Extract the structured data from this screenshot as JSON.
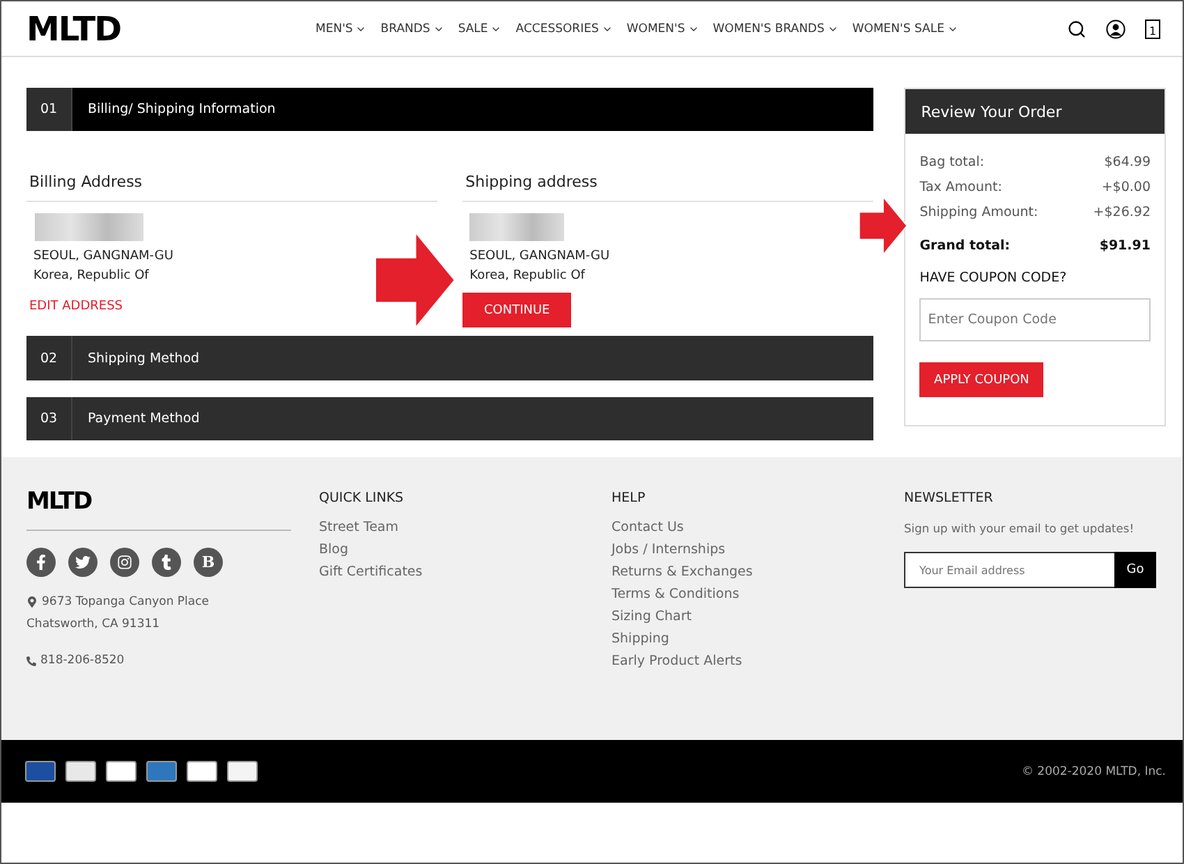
{
  "header": {
    "logo": "MLTD",
    "nav": [
      {
        "label": "MEN'S"
      },
      {
        "label": "BRANDS"
      },
      {
        "label": "SALE"
      },
      {
        "label": "ACCESSORIES"
      },
      {
        "label": "WOMEN'S"
      },
      {
        "label": "WOMEN'S BRANDS"
      },
      {
        "label": "WOMEN'S SALE"
      }
    ],
    "cart_count": "1"
  },
  "steps": [
    {
      "number": "01",
      "title": "Billing/ Shipping Information",
      "selected": true
    },
    {
      "number": "02",
      "title": "Shipping Method",
      "selected": false
    },
    {
      "number": "03",
      "title": "Payment Method",
      "selected": false
    }
  ],
  "billing": {
    "title": "Billing Address",
    "city": "SEOUL, GANGNAM-GU",
    "country": "Korea, Republic Of",
    "edit_link": "EDIT ADDRESS"
  },
  "shipping": {
    "title": "Shipping address",
    "city": "SEOUL, GANGNAM-GU",
    "country": "Korea, Republic Of",
    "button": "CONTINUE"
  },
  "review": {
    "title": "Review Your Order",
    "lines": [
      {
        "label": "Bag total:",
        "value": "$64.99"
      },
      {
        "label": "Tax Amount:",
        "value": "+$0.00"
      },
      {
        "label": "Shipping Amount:",
        "value": "+$26.92"
      }
    ],
    "grand_label": "Grand total:",
    "grand_value": "$91.91",
    "coupon_title": "HAVE COUPON CODE?",
    "coupon_placeholder": "Enter Coupon Code",
    "coupon_button": "APPLY COUPON"
  },
  "footer": {
    "logo": "MLTD",
    "social": [
      {
        "kind": "facebook"
      },
      {
        "kind": "twitter"
      },
      {
        "kind": "instagram"
      },
      {
        "kind": "tumblr"
      },
      {
        "kind": "letter",
        "label": "B"
      }
    ],
    "address": [
      "9673 Topanga Canyon Place",
      "Chatsworth, CA 91311"
    ],
    "phone": "818-206-8520",
    "quick_links": {
      "title": "QUICK LINKS",
      "links": [
        "Street Team",
        "Blog",
        "Gift Certificates"
      ]
    },
    "help": {
      "title": "HELP",
      "links": [
        "Contact Us",
        "Jobs / Internships",
        "Returns & Exchanges",
        "Terms & Conditions",
        "Sizing Chart",
        "Shipping",
        "Early Product Alerts"
      ]
    },
    "newsletter": {
      "title": "NEWSLETTER",
      "text": "Sign up with your email to get updates!",
      "placeholder": "Your Email address",
      "button": "Go"
    }
  },
  "bottom_bar": {
    "cards": [
      {
        "color": "#1d4fa0"
      },
      {
        "color": "#e8e8e8"
      },
      {
        "color": "#ffffff"
      },
      {
        "color": "#2e77bc"
      },
      {
        "color": "#ffffff"
      },
      {
        "color": "#f4f4f4"
      }
    ],
    "copyright": "© 2002-2020 MLTD, Inc."
  }
}
